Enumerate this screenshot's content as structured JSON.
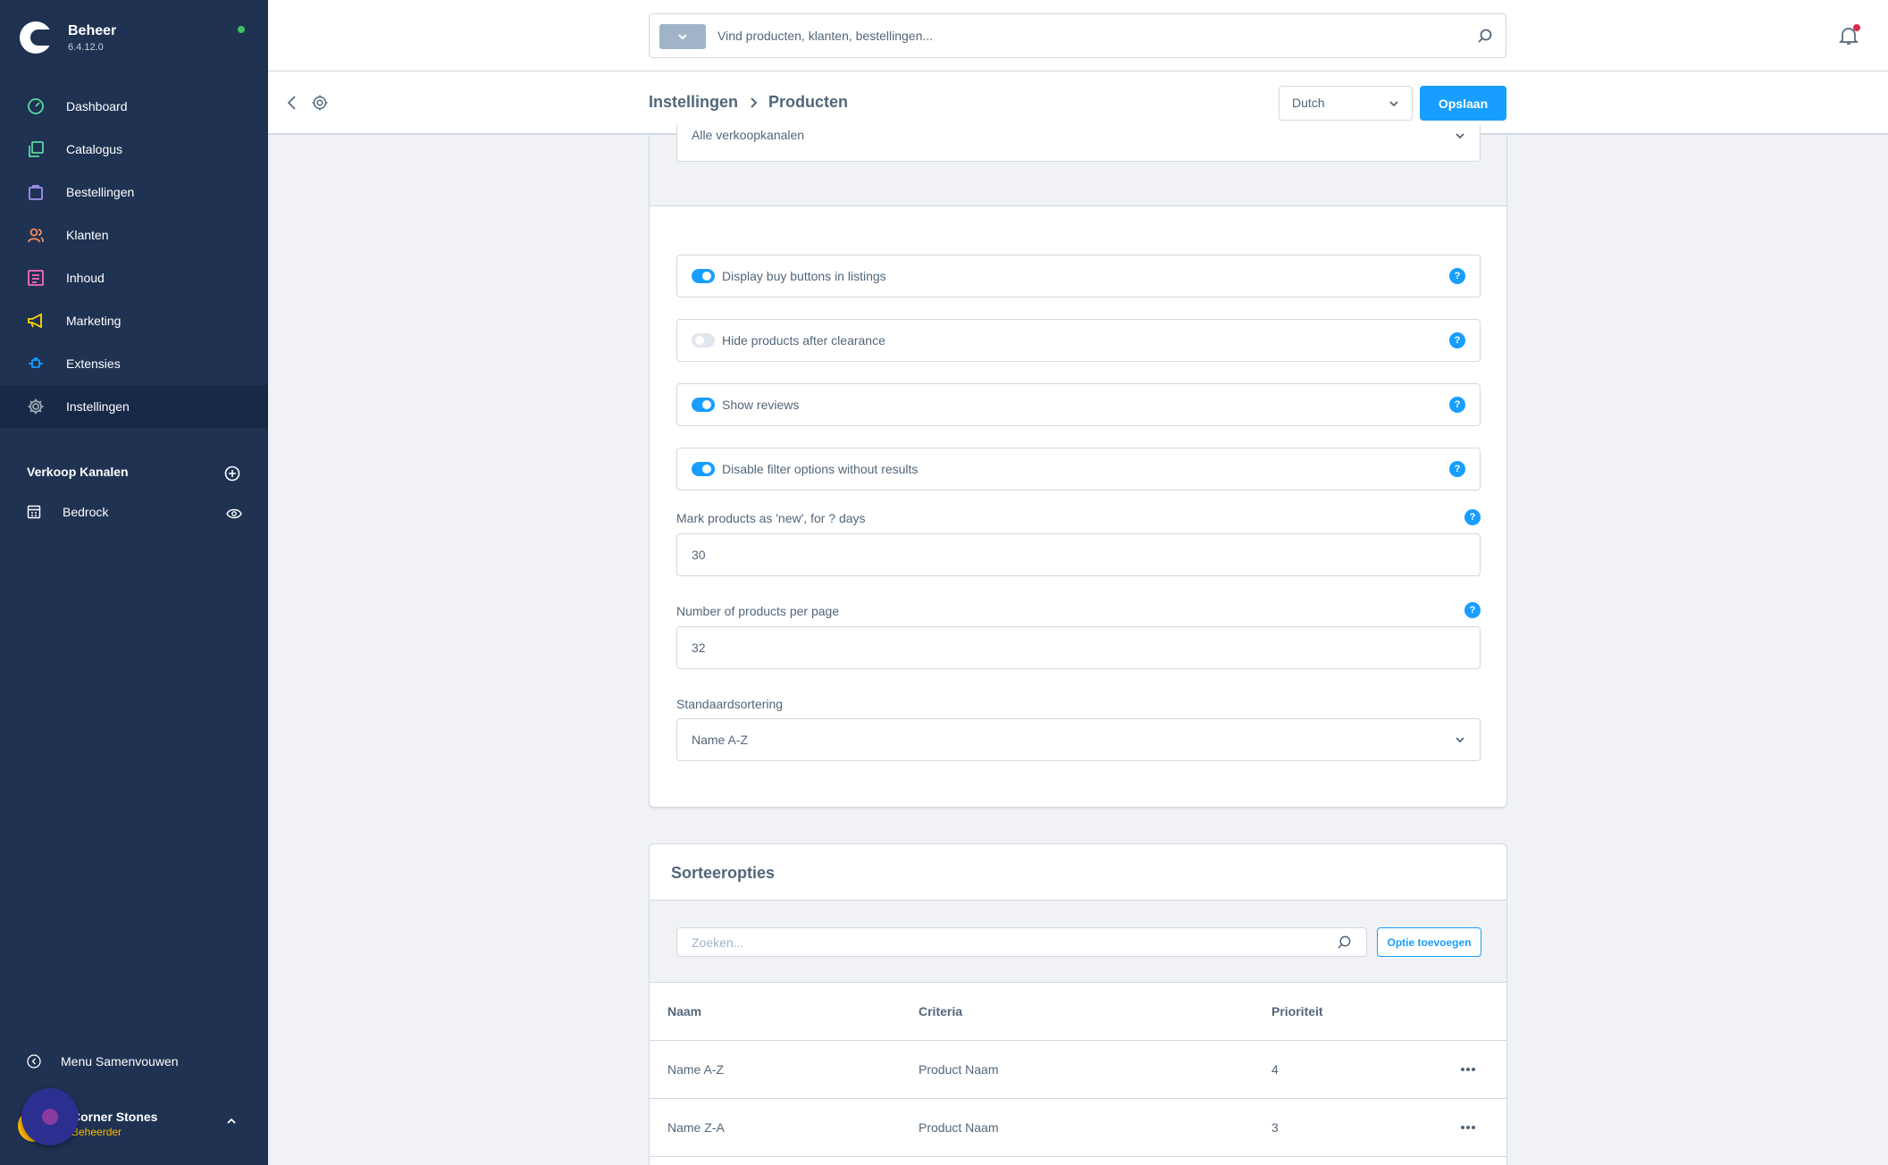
{
  "brand": {
    "title": "Beheer",
    "version": "6.4.12.0"
  },
  "nav": {
    "items": [
      {
        "label": "Dashboard",
        "icon": "dashboard-icon",
        "color": "#57d9a3"
      },
      {
        "label": "Catalogus",
        "icon": "catalog-icon",
        "color": "#57d9a3"
      },
      {
        "label": "Bestellingen",
        "icon": "orders-bag-icon",
        "color": "#a092f0"
      },
      {
        "label": "Klanten",
        "icon": "customers-icon",
        "color": "#f88962"
      },
      {
        "label": "Inhoud",
        "icon": "content-icon",
        "color": "#ff68b4"
      },
      {
        "label": "Marketing",
        "icon": "megaphone-icon",
        "color": "#ffd700"
      },
      {
        "label": "Extensies",
        "icon": "plug-icon",
        "color": "#189eff"
      },
      {
        "label": "Instellingen",
        "icon": "gear-icon",
        "color": "#9aa8b5",
        "active": true
      }
    ]
  },
  "channels": {
    "title": "Verkoop Kanalen",
    "items": [
      {
        "label": "Bedrock"
      }
    ]
  },
  "collapse_label": "Menu Samenvouwen",
  "user": {
    "name": "Corner Stones",
    "role": "Beheerder"
  },
  "search": {
    "placeholder": "Vind producten, klanten, bestellingen..."
  },
  "breadcrumb": {
    "parent": "Instellingen",
    "current": "Producten"
  },
  "language": {
    "selected": "Dutch"
  },
  "save_label": "Opslaan",
  "saleschannel": {
    "value": "Alle verkoopkanalen"
  },
  "switches": [
    {
      "label": "Display buy buttons in listings",
      "on": true
    },
    {
      "label": "Hide products after clearance",
      "on": false
    },
    {
      "label": "Show reviews",
      "on": true
    },
    {
      "label": "Disable filter options without results",
      "on": true
    }
  ],
  "fields": {
    "new_days": {
      "label": "Mark products as 'new', for ? days",
      "value": "30"
    },
    "per_page": {
      "label": "Number of products per page",
      "value": "32"
    },
    "sorting": {
      "label": "Standaardsortering",
      "value": "Name A-Z"
    }
  },
  "sort_options": {
    "title": "Sorteeropties",
    "search_placeholder": "Zoeken...",
    "add_label": "Optie toevoegen",
    "columns": {
      "name": "Naam",
      "criteria": "Criteria",
      "priority": "Prioriteit"
    },
    "rows": [
      {
        "name": "Name A-Z",
        "criteria": "Product Naam",
        "priority": "4"
      },
      {
        "name": "Name Z-A",
        "criteria": "Product Naam",
        "priority": "3"
      }
    ]
  },
  "help_glyph": "?",
  "colors": {
    "sidebar": "#1f3252",
    "accent": "#189eff",
    "status_online": "#3cc261",
    "user_role": "#ffb800"
  }
}
